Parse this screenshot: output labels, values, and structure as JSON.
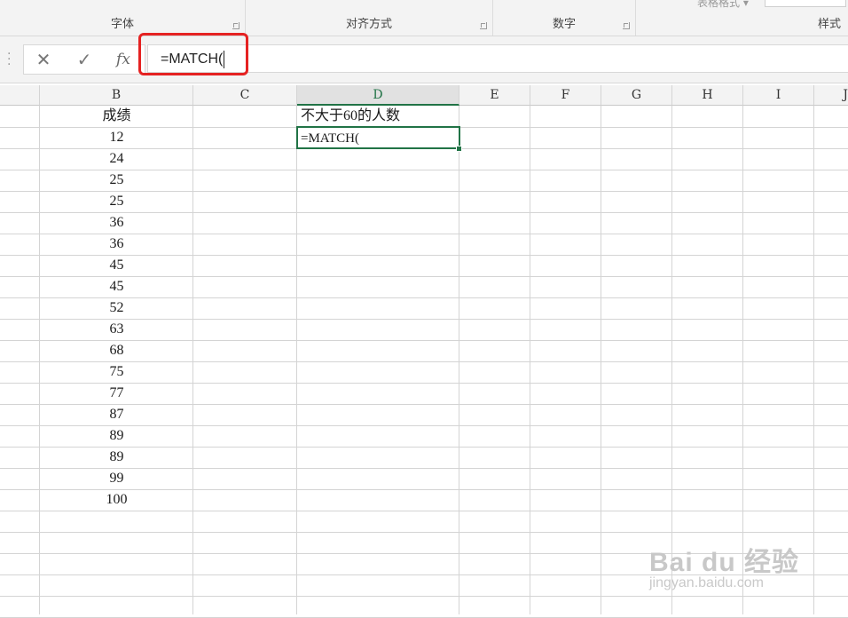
{
  "ribbon": {
    "groups": [
      {
        "label": "字体"
      },
      {
        "label": "对齐方式"
      },
      {
        "label": "数字"
      },
      {
        "label": "样式"
      }
    ],
    "table_style_label": "表格格式 ▾"
  },
  "formula_bar": {
    "cancel_icon": "close-icon",
    "enter_icon": "check-icon",
    "fx_label": "fx",
    "formula": "=MATCH("
  },
  "columns": [
    "B",
    "C",
    "D",
    "E",
    "F",
    "G",
    "H",
    "I",
    "J"
  ],
  "active_column": "D",
  "sheet": {
    "b_header": "成绩",
    "b_values": [
      "12",
      "24",
      "25",
      "25",
      "36",
      "36",
      "45",
      "45",
      "52",
      "63",
      "68",
      "75",
      "77",
      "87",
      "89",
      "89",
      "99",
      "100"
    ],
    "d1": "不大于60的人数",
    "d2": "=MATCH("
  },
  "watermark": {
    "logo": "Bai du 经验",
    "url": "jingyan.baidu.com"
  }
}
